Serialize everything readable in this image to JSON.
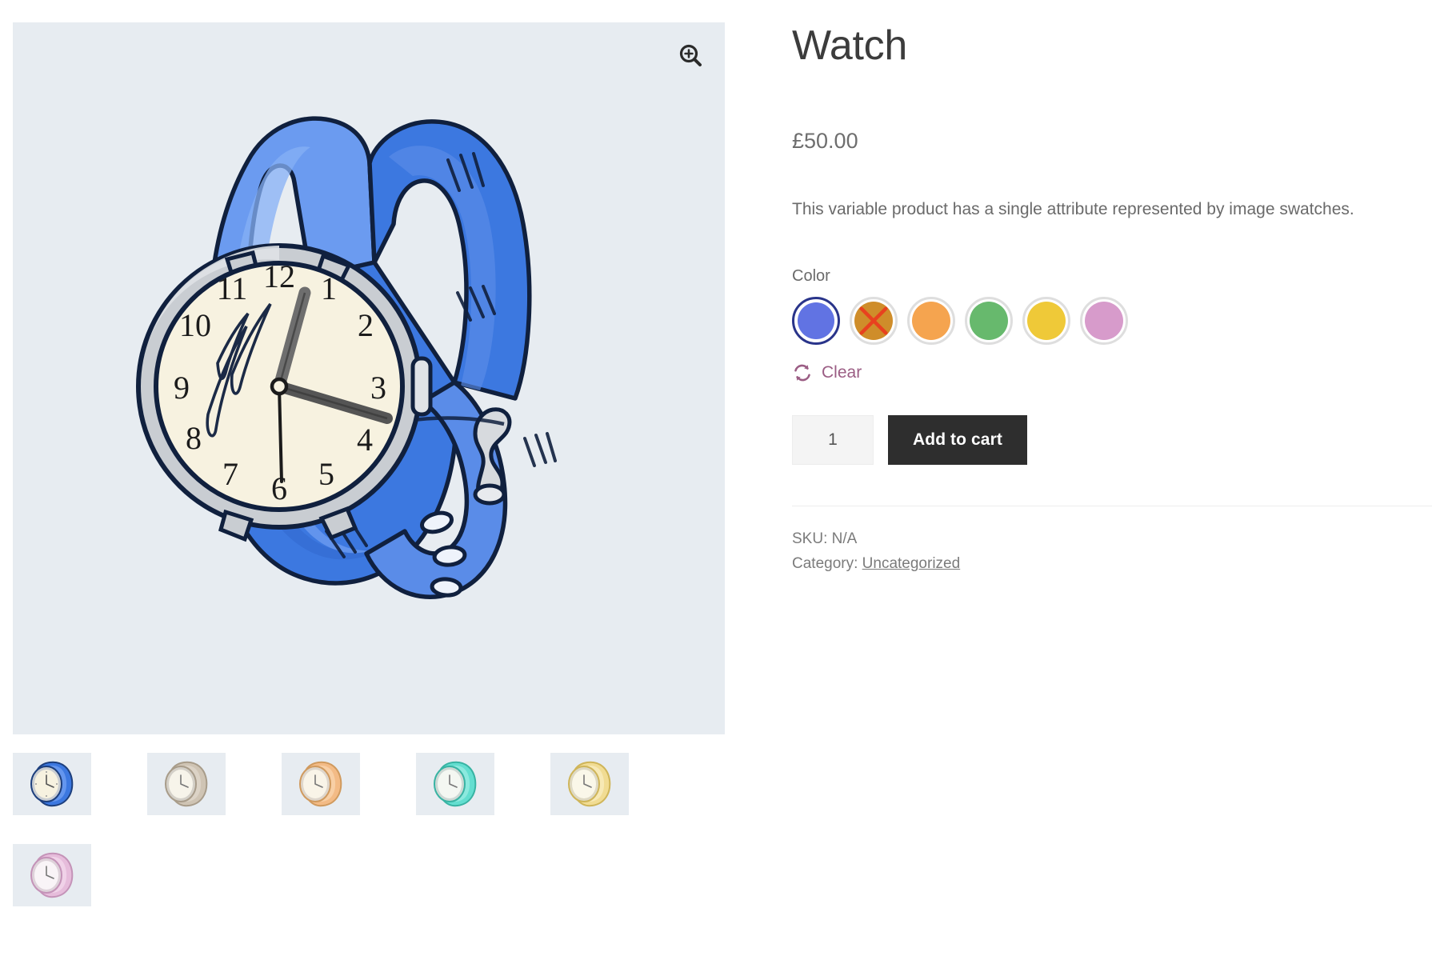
{
  "product": {
    "title": "Watch",
    "price": "£50.00",
    "description": "This variable product has a single attribute represented by image swatches."
  },
  "gallery": {
    "zoom_icon": "zoom-in-magnifier-icon",
    "main_image_alt": "Blue strap watch illustration",
    "background_color": "#e7ecf1",
    "thumbnails": [
      {
        "name": "Blue",
        "strap": "#3c78e0",
        "strap_light": "#6b9bf0",
        "strap_dark": "#2a5fc4",
        "face": "#f5f1e0",
        "case": "#c9cdd2",
        "selected": true
      },
      {
        "name": "Beige",
        "strap": "#cfc4b4",
        "strap_light": "#ded6c9",
        "strap_dark": "#b8ab98",
        "face": "#f7f4ea",
        "case": "#d4d0c8",
        "selected": false
      },
      {
        "name": "Orange",
        "strap": "#f3bb86",
        "strap_light": "#f8d2aa",
        "strap_dark": "#e6a262",
        "face": "#f9f4e8",
        "case": "#ded6cc",
        "selected": false
      },
      {
        "name": "Teal",
        "strap": "#63ded0",
        "strap_light": "#93ebe1",
        "strap_dark": "#42c9b8",
        "face": "#f4f7f2",
        "case": "#cdd8d4",
        "selected": false
      },
      {
        "name": "Yellow",
        "strap": "#f1dc93",
        "strap_light": "#f8ebbb",
        "strap_dark": "#e2c86e",
        "face": "#faf7e9",
        "case": "#ded9c4",
        "selected": false
      },
      {
        "name": "Pink",
        "strap": "#e6bcdb",
        "strap_light": "#f1d6ea",
        "strap_dark": "#d5a2c9",
        "face": "#f9f4f7",
        "case": "#ded2da",
        "selected": false
      }
    ]
  },
  "attribute": {
    "label": "Color",
    "swatches": [
      {
        "name": "Blue",
        "color": "#6173e3",
        "selected": true,
        "disabled": false
      },
      {
        "name": "Brown",
        "color": "#cf8d2a",
        "selected": false,
        "disabled": true,
        "cross_color": "#e8411f"
      },
      {
        "name": "Orange",
        "color": "#f5a44f",
        "selected": false,
        "disabled": false
      },
      {
        "name": "Green",
        "color": "#67b96d",
        "selected": false,
        "disabled": false
      },
      {
        "name": "Yellow",
        "color": "#efc938",
        "selected": false,
        "disabled": false
      },
      {
        "name": "Pink",
        "color": "#d79bcb",
        "selected": false,
        "disabled": false
      }
    ],
    "clear_label": "Clear",
    "clear_icon": "reset-refresh-icon",
    "clear_color": "#9b5d84"
  },
  "cart": {
    "quantity_value": "1",
    "quantity_placeholder": "1",
    "add_to_cart_label": "Add to cart",
    "button_color": "#2e2e2e"
  },
  "meta": {
    "sku_line": "SKU: N/A",
    "category_prefix": "Category:",
    "category_value": "Uncategorized"
  }
}
